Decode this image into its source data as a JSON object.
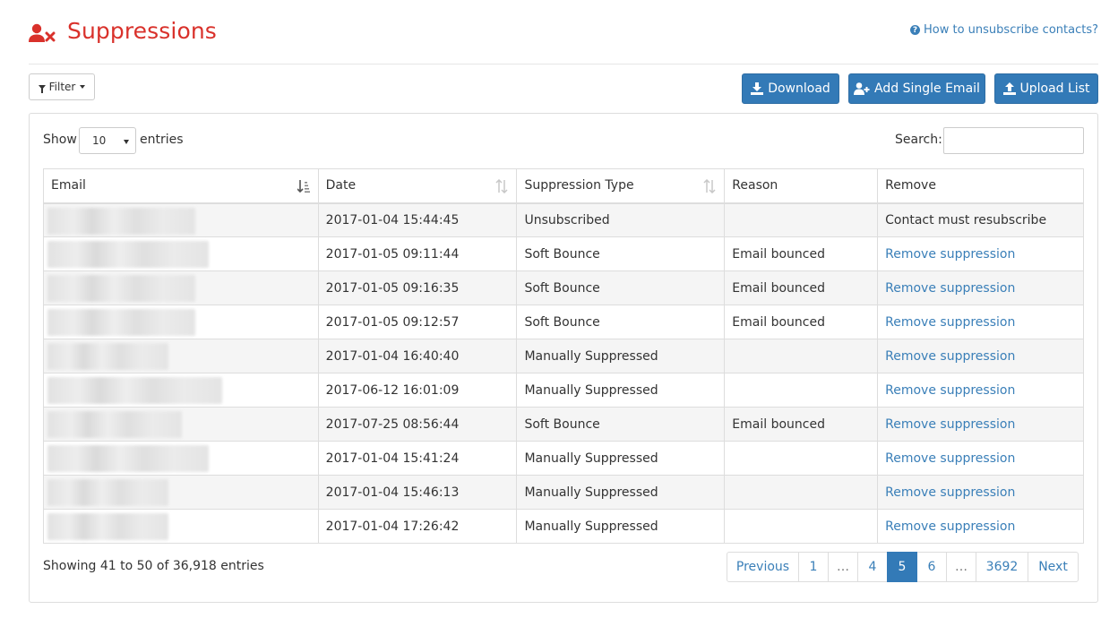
{
  "header": {
    "title": "Suppressions",
    "help_link": "How to unsubscribe contacts?"
  },
  "toolbar": {
    "filter_label": "Filter",
    "download_label": "Download",
    "add_single_email_label": "Add Single Email",
    "upload_list_label": "Upload List"
  },
  "controls": {
    "show_label": "Show",
    "page_size": "10",
    "entries_label": "entries",
    "search_label": "Search:",
    "search_value": ""
  },
  "table": {
    "columns": [
      "Email",
      "Date",
      "Suppression Type",
      "Reason",
      "Remove"
    ],
    "rows": [
      {
        "email": "",
        "date": "2017-01-04 15:44:45",
        "type": "Unsubscribed",
        "reason": "",
        "remove": "Contact must resubscribe"
      },
      {
        "email": "",
        "date": "2017-01-05 09:11:44",
        "type": "Soft Bounce",
        "reason": "Email bounced",
        "remove": "Remove suppression"
      },
      {
        "email": "",
        "date": "2017-01-05 09:16:35",
        "type": "Soft Bounce",
        "reason": "Email bounced",
        "remove": "Remove suppression"
      },
      {
        "email": "",
        "date": "2017-01-05 09:12:57",
        "type": "Soft Bounce",
        "reason": "Email bounced",
        "remove": "Remove suppression"
      },
      {
        "email": "",
        "date": "2017-01-04 16:40:40",
        "type": "Manually Suppressed",
        "reason": "",
        "remove": "Remove suppression"
      },
      {
        "email": "",
        "date": "2017-06-12 16:01:09",
        "type": "Manually Suppressed",
        "reason": "",
        "remove": "Remove suppression"
      },
      {
        "email": "",
        "date": "2017-07-25 08:56:44",
        "type": "Soft Bounce",
        "reason": "Email bounced",
        "remove": "Remove suppression"
      },
      {
        "email": "",
        "date": "2017-01-04 15:41:24",
        "type": "Manually Suppressed",
        "reason": "",
        "remove": "Remove suppression"
      },
      {
        "email": "",
        "date": "2017-01-04 15:46:13",
        "type": "Manually Suppressed",
        "reason": "",
        "remove": "Remove suppression"
      },
      {
        "email": "",
        "date": "2017-01-04 17:26:42",
        "type": "Manually Suppressed",
        "reason": "",
        "remove": "Remove suppression"
      }
    ]
  },
  "footer": {
    "info": "Showing 41 to 50 of 36,918 entries"
  },
  "pagination": {
    "previous": "Previous",
    "next": "Next",
    "pages": [
      "1",
      "…",
      "4",
      "5",
      "6",
      "…",
      "3692"
    ],
    "active_page": "5"
  },
  "colors": {
    "brand_red": "#d9312b",
    "primary_blue": "#337ab7",
    "link_blue": "#3a7fb8"
  },
  "icons": {
    "title": "user-remove-icon",
    "help": "question-circle-icon",
    "filter": "funnel-icon",
    "download": "download-icon",
    "add_email": "user-plus-icon",
    "upload": "upload-icon",
    "sort": "sort-icon"
  }
}
